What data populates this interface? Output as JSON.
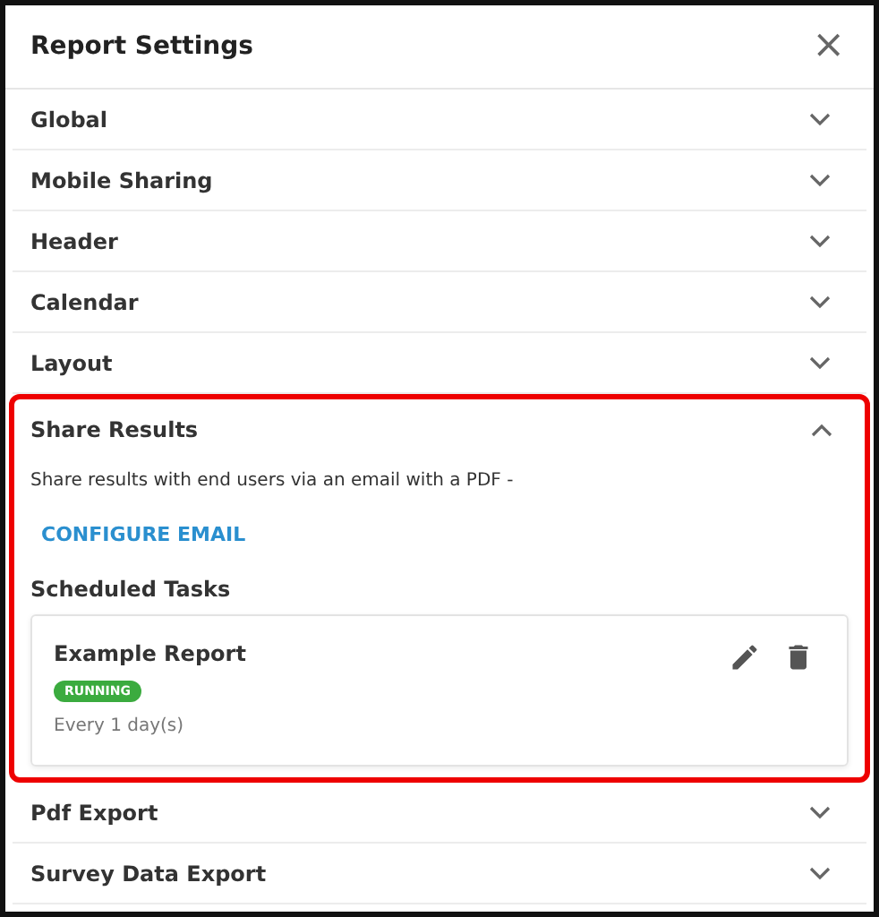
{
  "dialog": {
    "title": "Report Settings",
    "close": "×"
  },
  "sections": [
    {
      "label": "Global",
      "expanded": false,
      "highlighted": false
    },
    {
      "label": "Mobile Sharing",
      "expanded": false,
      "highlighted": false
    },
    {
      "label": "Header",
      "expanded": false,
      "highlighted": false
    },
    {
      "label": "Calendar",
      "expanded": false,
      "highlighted": false
    },
    {
      "label": "Layout",
      "expanded": false,
      "highlighted": false
    },
    {
      "label": "Share Results",
      "expanded": true,
      "highlighted": true,
      "content": {
        "description": "Share results with end users via an email with a PDF -",
        "link": "CONFIGURE EMAIL",
        "subheading": "Scheduled Tasks",
        "tasks": [
          {
            "name": "Example Report",
            "status": "RUNNING",
            "color": "#3bab3f",
            "schedule": "Every 1 day(s)"
          }
        ]
      }
    },
    {
      "label": "Pdf Export",
      "expanded": false,
      "highlighted": false
    },
    {
      "label": "Survey Data Export",
      "expanded": false,
      "highlighted": false
    }
  ]
}
